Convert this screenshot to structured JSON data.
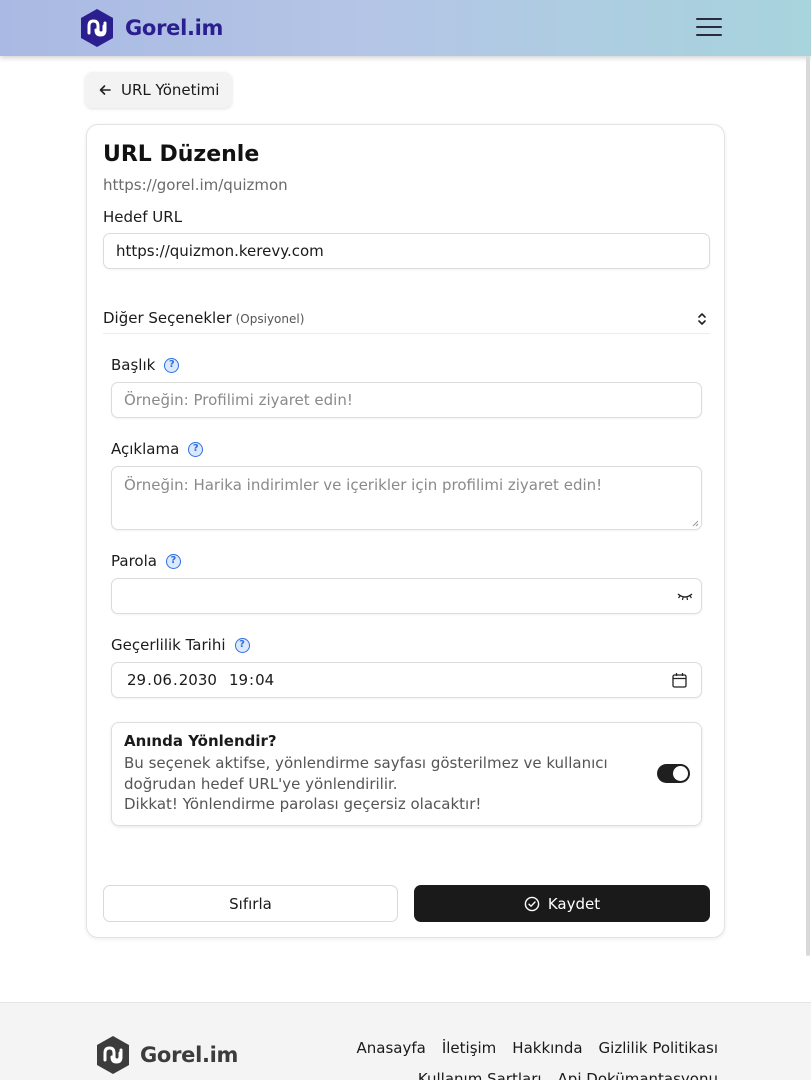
{
  "brand": {
    "name": "Gorel.im"
  },
  "header": {
    "menu_icon": "hamburger-icon"
  },
  "back": {
    "label": "URL Yönetimi",
    "icon": "arrow-left-icon"
  },
  "card": {
    "title": "URL Düzenle",
    "short_url": "https://gorel.im/quizmon",
    "target_label": "Hedef URL",
    "target_value": "https://quizmon.kerevy.com",
    "options": {
      "title": "Diğer Seçenekler",
      "hint": "(Opsiyonel)"
    },
    "fields": {
      "title": {
        "label": "Başlık",
        "placeholder": "Örneğin: Profilimi ziyaret edin!"
      },
      "description": {
        "label": "Açıklama",
        "placeholder": "Örneğin: Harika indirimler ve içerikler için profilimi ziyaret edin!"
      },
      "password": {
        "label": "Parola",
        "value": ""
      },
      "expiry": {
        "label": "Geçerlilik Tarihi",
        "day": "29",
        "month": "06",
        "year": "2030",
        "hour": "19",
        "minute": "04"
      }
    },
    "instant_redirect": {
      "title": "Anında Yönlendir?",
      "line1": "Bu seçenek aktifse, yönlendirme sayfası gösterilmez ve kullanıcı doğrudan hedef URL'ye yönlendirilir.",
      "line2": "Dikkat! Yönlendirme parolası geçersiz olacaktır!",
      "enabled": true
    },
    "reset_label": "Sıfırla",
    "save_label": "Kaydet"
  },
  "footer": {
    "links": [
      "Anasayfa",
      "İletişim",
      "Hakkında",
      "Gizlilik Politikası"
    ],
    "links2": [
      "Kullanım Şartları",
      "Api Dokümantasyonu"
    ]
  },
  "colors": {
    "brand": "#2b1f8f",
    "help": "#2f6fe0",
    "primary_button": "#1a1a1a"
  }
}
